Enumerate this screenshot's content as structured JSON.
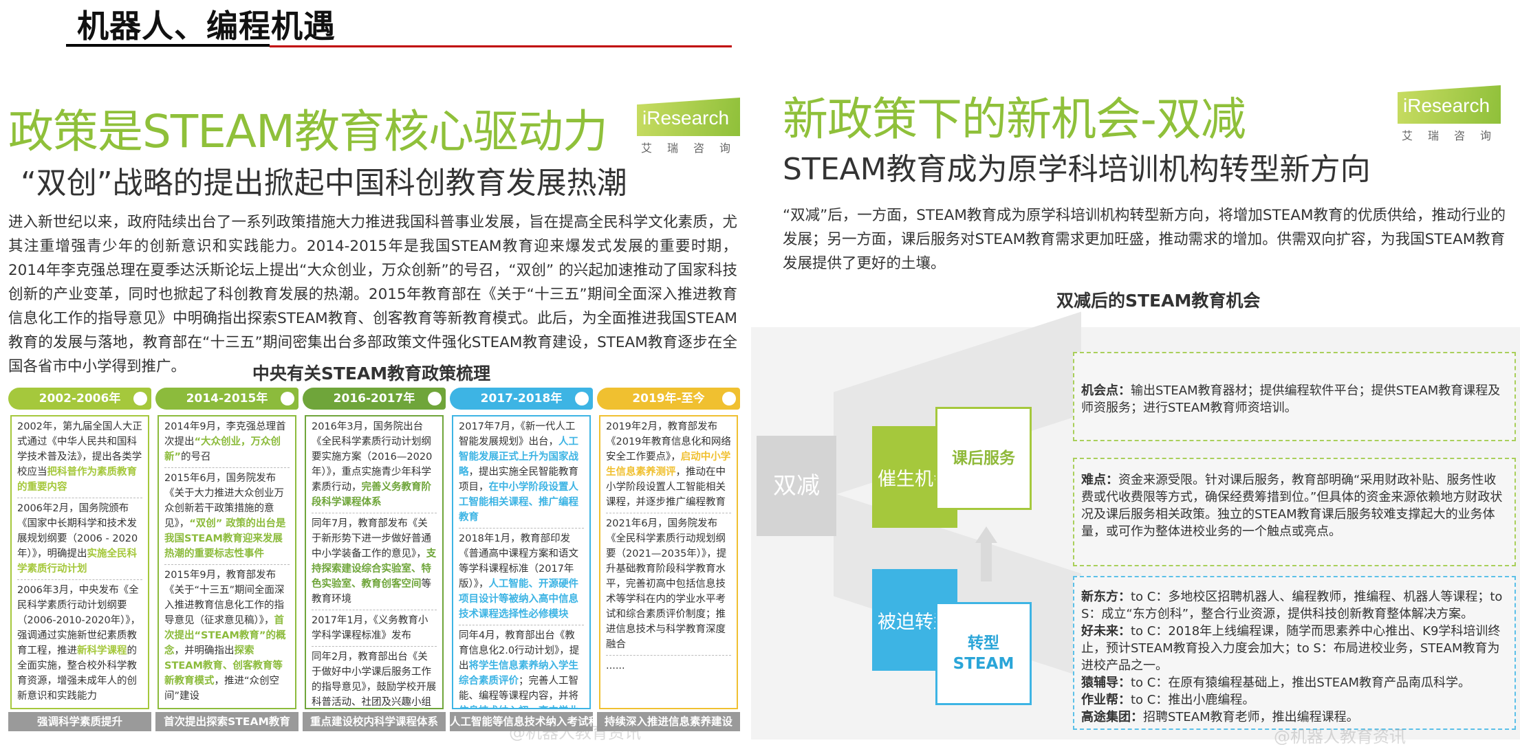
{
  "header": {
    "title": "机器人、编程机遇"
  },
  "left": {
    "title": "政策是STEAM教育核心驱动力",
    "subtitle": "“双创”战略的提出掀起中国科创教育发展热潮",
    "paragraph": "进入新世纪以来，政府陆续出台了一系列政策措施大力推进我国科普事业发展，旨在提高全民科学文化素质，尤其注重增强青少年的创新意识和实践能力。2014-2015年是我国STEAM教育迎来爆发式发展的重要时期，2014年李克强总理在夏季达沃斯论坛上提出“大众创业，万众创新”的号召，“双创” 的兴起加速推动了国家科技创新的产业变革，同时也掀起了科创教育发展的热潮。2015年教育部在《关于“十三五”期间全面深入推进教育信息化工作的指导意见》中明确指出探索STEAM教育、创客教育等新教育模式。此后，为全面推进我国STEAM教育的发展与落地，教育部在“十三五”期间密集出台多部政策文件强化STEAM教育建设，STEAM教育逐步在全国各省市中小学得到推广。",
    "logo": {
      "brand": "iResearch",
      "sub": "艾瑞咨询"
    },
    "table_title": "中央有关STEAM教育政策梳理",
    "columns": [
      {
        "period": "2002-2006年",
        "color": "#a5c83c",
        "entries": [
          {
            "text": "2002年，第九届全国人大正式通过《中华人民共和国科学技术普及法》，提出各类学校应当",
            "highlight": "把科普作为素质教育的重要内容"
          },
          {
            "text": "2006年2月，国务院颁布《国家中长期科学和技术发展规划纲要（2006 - 2020年）》，明确提出",
            "highlight": "实施全民科学素质行动计划"
          },
          {
            "text": "2006年3月，中央发布《全民科学素质行动计划纲要（2006-2010-2020年）》，强调通过实施新世纪素质教育工程，推进",
            "highlight": "新科学课程",
            "tail": "的全面实施，整合校外科学教育资源，增强未成年人的创新意识和实践能力"
          }
        ],
        "footer": "强调科学素质提升"
      },
      {
        "period": "2014-2015年",
        "color": "#8cbb3c",
        "entries": [
          {
            "text": "2014年9月，李克强总理首次提出",
            "highlight": "“大众创业，万众创新”",
            "tail": "的号召"
          },
          {
            "text": "2015年6月，国务院发布《关于大力推进大众创业万众创新若干政策措施的意见》，",
            "highlight": "“双创” 政策的出台是我国STEAM教育迎来发展热潮的重要标志性事件"
          },
          {
            "text": "2015年9月，教育部发布《关于“十三五”期间全面深入推进教育信息化工作的指导意见（征求意见稿）》，",
            "highlight": "首次提出“STEAM教育”的概念",
            "tail": "，并明确指出",
            "highlight2": "探索STEAM教育、创客教育等新教育模式",
            "tail2": "，推进“众创空间”建设"
          }
        ],
        "footer": "首次提出探索STEAM教育"
      },
      {
        "period": "2016-2017年",
        "color": "#6fa53a",
        "entries": [
          {
            "text": "2016年3月，国务院出台《全民科学素质行动计划纲要实施方案（2016—2020年）》，重点实施青少年科学素质行动，",
            "highlight": "完善义务教育阶段科学课程体系"
          },
          {
            "text": "同年7月，教育部发布《关于新形势下进一步做好普通中小学装备工作的意见》，",
            "highlight": "支持探索建设综合实验室、特色实验室、教育创客空间",
            "tail": "等教育环境"
          },
          {
            "text": "2017年1月，《义务教育小学科学课程标准》发布"
          },
          {
            "text": "同年2月，教育部出台《关于做好中小学课后服务工作的指导意见》，鼓励学校开展科普活动、社团及兴趣小组活动"
          }
        ],
        "footer": "重点建设校内科学课程体系"
      },
      {
        "period": "2017-2018年",
        "color": "#3db4e4",
        "entries": [
          {
            "text": "2017年7月，《新一代人工智能发展规划》出台，",
            "highlight": "人工智能发展正式上升为国家战略",
            "tail": "，提出实施全民智能教育项目，",
            "highlight2": "在中小学阶段设置人工智能相关课程、推广编程教育"
          },
          {
            "text": "2018年1月，教育部印发《普通高中课程方案和语文等学科课程标准（2017年版）》，",
            "highlight": "人工智能、开源硬件项目设计等被纳入高中信息技术课程选择性必修模块"
          },
          {
            "text": "同年4月，教育部出台《教育信息化2.0行动计划》，提出",
            "highlight": "将学生信息素养纳入学生综合素质评价",
            "tail": "；完善人工智能、编程等课程内容，并将",
            "highlight2": "信息技术纳入初、高中学业水平考试"
          }
        ],
        "footer": "人工智能等信息技术纳入考试科目"
      },
      {
        "period": "2019年-至今",
        "color": "#f0c030",
        "entries": [
          {
            "text": "2019年2月，教育部发布《2019年教育信息化和网络安全工作要点》，",
            "highlight": "启动中小学生信息素养测评",
            "tail": "，推动在中小学阶段设置人工智能相关课程，并逐步推广编程教育"
          },
          {
            "text": "2021年6月，国务院发布《全民科学素质行动规划纲要（2021—2035年）》，提升基础教育阶段科学教育水平，完善初高中包括信息技术等学科在内的学业水平考试和综合素质评价制度；推进信息技术与科学教育深度融合"
          },
          {
            "text": "......"
          }
        ],
        "footer": "持续深入推进信息素养建设"
      }
    ],
    "watermark": "@机器人教育资讯"
  },
  "right": {
    "title": "新政策下的新机会-双减",
    "subtitle": "STEAM教育成为原学科培训机构转型新方向",
    "paragraph": "“双减”后，一方面，STEAM教育成为原学科培训机构转型新方向，将增加STEAM教育的优质供给，推动行业的发展；另一方面，课后服务对STEAM教育需求更加旺盛，推动需求的增加。供需双向扩容，为我国STEAM教育发展提供了更好的土壤。",
    "logo": {
      "brand": "iResearch",
      "sub": "艾瑞咨询"
    },
    "chart_title": "双减后的STEAM教育机会",
    "diagram": {
      "root": "双减",
      "top_box": "催生机会",
      "top_box_side": "课后服务",
      "bottom_box": "被迫转型",
      "bottom_box_side_1": "转型",
      "bottom_box_side_2": "STEAM",
      "colors": {
        "green": "#a5c83c",
        "blue": "#3db4e4",
        "grey": "#d4d4d4"
      }
    },
    "info_boxes": [
      {
        "key": "机会点：",
        "text": "输出STEAM教育器材；提供编程软件平台；提供STEAM教育课程及师资服务；进行STEAM教育师资培训。"
      },
      {
        "key": "难点：",
        "text": "资金来源受限。针对课后服务，教育部明确“采用财政补贴、服务性收费或代收费限等方式，确保经费筹措到位。”但具体的资金来源依赖地方财政状况及课后服务相关政策。独立的STEAM教育课后服务较难支撑起大的业务体量，或可作为整体进校业务的一个触点或亮点。"
      },
      {
        "lines": [
          {
            "key": "新东方：",
            "text": "to C：多地校区招聘机器人、编程教师，推编程、机器人等课程；to S：成立“东方创科”，整合行业资源，提供科技创新教育整体解决方案。"
          },
          {
            "key": "好未来：",
            "text": "to C：2018年上线编程课，随学而思素养中心推出、K9学科培训终止，预计STEAM教育投入力度会加大；to S：布局进校业务，STEAM教育为进校产品之一。"
          },
          {
            "key": "猿辅导：",
            "text": "to C：在原有猿编程基础上，推出STEAM教育产品南瓜科学。"
          },
          {
            "key": "作业帮：",
            "text": "to C：推出小鹿编程。"
          },
          {
            "key": "高途集团：",
            "text": "招聘STEAM教育老师，推出编程课程。"
          }
        ]
      }
    ],
    "watermark": "@机器人教育资讯"
  }
}
